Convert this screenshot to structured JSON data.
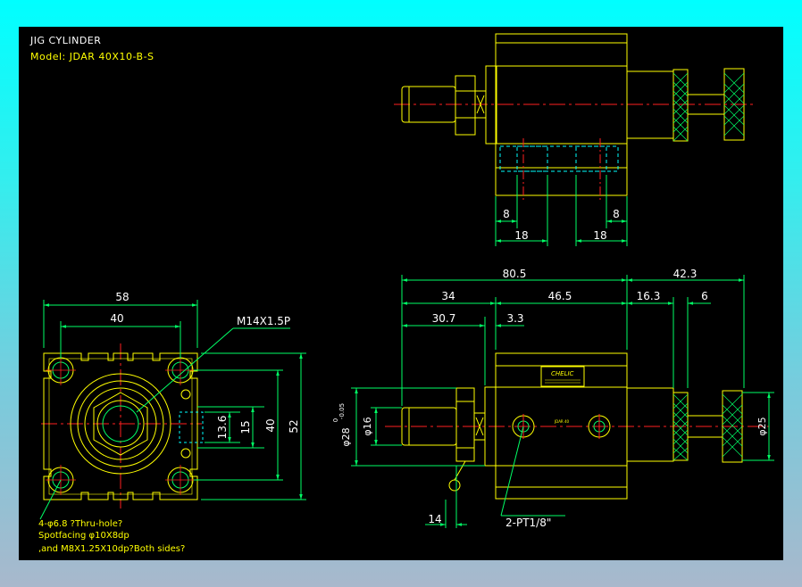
{
  "title": "JIG CYLINDER",
  "model": "Model:  JDAR 40X10-B-S",
  "colors": {
    "background": "#000000",
    "yellow": "#ffff00",
    "green": "#00ff66",
    "white": "#ffffff",
    "red": "#ff2020",
    "cyan": "#00ffff",
    "frame": "#00ffff"
  },
  "front_view": {
    "dim_58": "58",
    "dim_40_top": "40",
    "thread_label": "M14X1.5P",
    "dim_13_6": "13.6",
    "dim_15": "15",
    "dim_40_side": "40",
    "dim_52": "52",
    "notes": [
      "4-φ6.8 ?Thru-hole?",
      "Spotfacing  φ10X8dp",
      ",and M8X1.25X10dp?Both sides?"
    ]
  },
  "top_view": {
    "dim_8_left": "8",
    "dim_8_right": "8",
    "dim_18_left": "18",
    "dim_18_right": "18"
  },
  "side_view": {
    "dim_80_5": "80.5",
    "dim_42_3": "42.3",
    "dim_34": "34",
    "dim_46_5": "46.5",
    "dim_16_3": "16.3",
    "dim_6": "6",
    "dim_30_7": "30.7",
    "dim_3_3": "3.3",
    "dim_28": "φ28",
    "dim_28_tol_upper": "0",
    "dim_28_tol_lower": "-0.05",
    "dim_16": "φ16",
    "dim_25": "φ25",
    "dim_14": "14",
    "port_label": "2-PT1/8\"",
    "brand": "CHELIC",
    "nameplate_small": "JDAR 40"
  }
}
